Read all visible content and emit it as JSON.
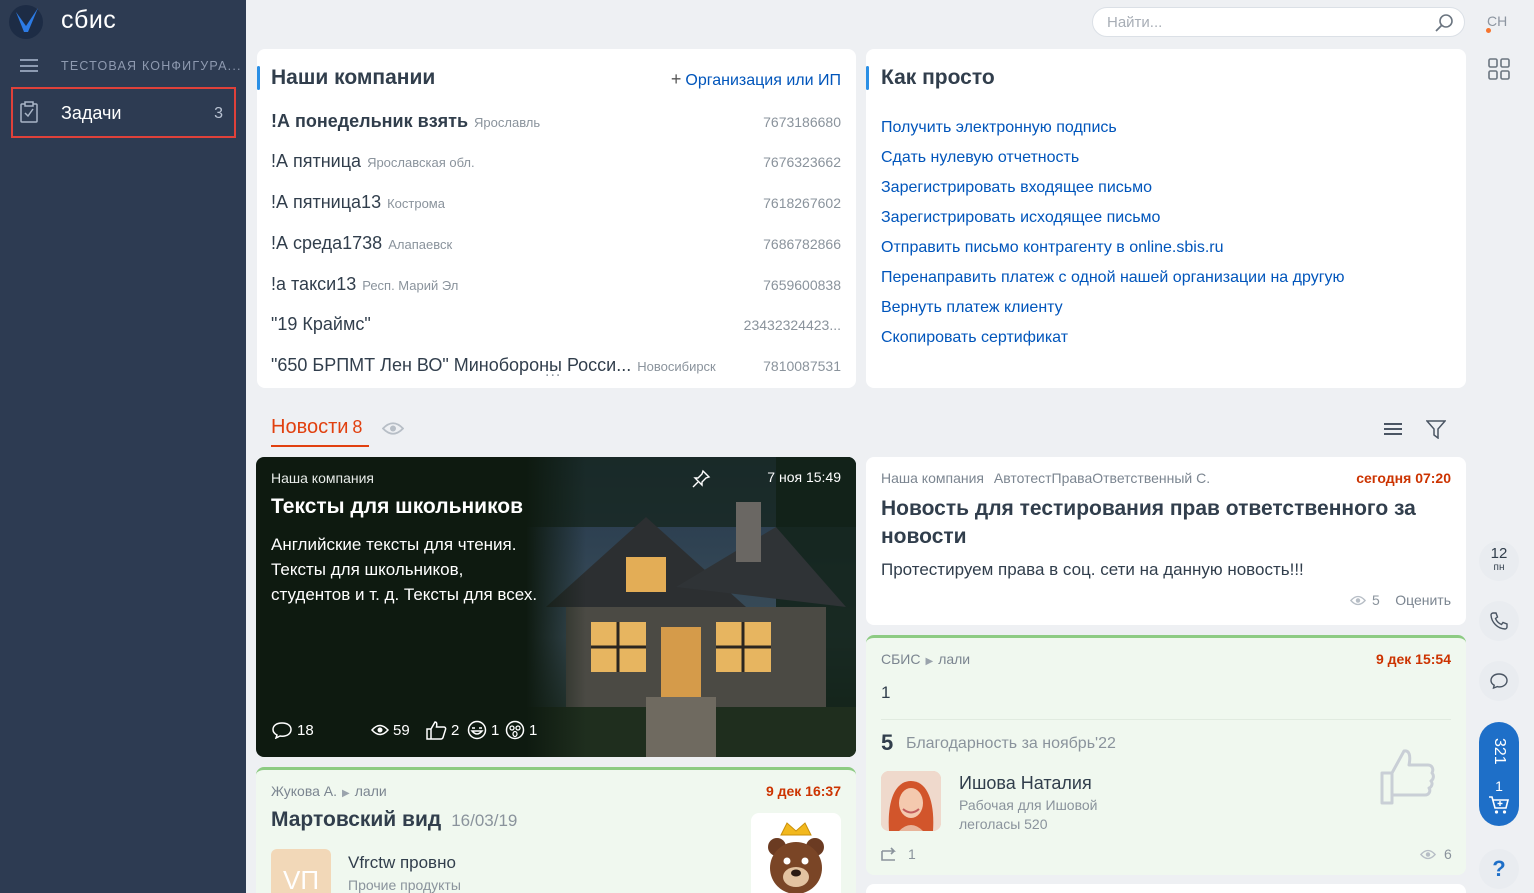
{
  "sidebar": {
    "brand": "сбис",
    "config": "ТЕСТОВАЯ КОНФИГУРА...",
    "nav_item": {
      "label": "Задачи",
      "count": "3"
    }
  },
  "topbar": {
    "search_placeholder": "Найти...",
    "user_initials": "СН"
  },
  "companies": {
    "title": "Наши компании",
    "add_label": "Организация или ИП",
    "rows": [
      {
        "name": "!А понедельник взять",
        "city": "Ярославль",
        "inn": "7673186680"
      },
      {
        "name": "!А пятница",
        "city": "Ярославская обл.",
        "inn": "7676323662"
      },
      {
        "name": "!А пятница13",
        "city": "Кострома",
        "inn": "7618267602"
      },
      {
        "name": "!А среда1738",
        "city": "Алапаевск",
        "inn": "7686782866"
      },
      {
        "name": "!а такси13",
        "city": "Респ. Марий Эл",
        "inn": "7659600838"
      },
      {
        "name": "\"19 Краймс\"",
        "city": "",
        "inn": "23432324423..."
      },
      {
        "name": "\"650 БРПМТ Лен ВО\" Минобороны Росси...",
        "city": "Новосибирск",
        "inn": "7810087531"
      }
    ],
    "more": "..."
  },
  "howto": {
    "title": "Как просто",
    "links": [
      "Получить электронную подпись",
      "Сдать нулевую отчетность",
      "Зарегистрировать входящее письмо",
      "Зарегистрировать исходящее письмо",
      "Отправить письмо контрагенту в online.sbis.ru",
      "Перенаправить платеж с одной нашей организации на другую",
      "Вернуть платеж клиенту",
      "Скопировать сертификат"
    ]
  },
  "news": {
    "title": "Новости",
    "count": "8",
    "featured": {
      "company": "Наша компания",
      "date": "7 ноя 15:49",
      "title": "Тексты для школьников",
      "text": "Английские тексты для чтения. Тексты для школьников, студентов и т. д. Тексты для всех.",
      "comments": "18",
      "views": "59",
      "likes": "2",
      "laughs": "1",
      "wows": "1"
    },
    "item1": {
      "company": "Наша компания",
      "author": "АвтотестПраваОтветственный С.",
      "date": "сегодня 07:20",
      "title": "Новость для тестирования прав ответственного за новости",
      "text": "Протестируем права в соц. сети на данную новость!!!",
      "views": "5",
      "rate": "Оценить"
    },
    "item2": {
      "source": "СБИС",
      "channel": "лали",
      "date": "9 дек 15:54",
      "body": "1",
      "thanks_num": "5",
      "thanks_text": "Благодарность за ноябрь'22",
      "person_name": "Ишова Наталия",
      "person_role": "Рабочая для Ишовой",
      "person_place": "леголасы 520",
      "reposts": "1",
      "views": "6"
    },
    "item3": {
      "author": "Жукова А.",
      "channel": "лали",
      "date": "9 дек 16:37",
      "title": "Мартовский вид",
      "sub_date": "16/03/19",
      "badge": "VП",
      "product_name": "Vfrctw провно",
      "product_cat": "Прочие продукты"
    }
  },
  "rail": {
    "day": "12",
    "weekday": "пн",
    "cart_count": "321",
    "cart_items": "1",
    "help": "?"
  },
  "colors": {
    "sidebar": "#2d3b52",
    "accent": "#e1400f",
    "link": "#0055bb",
    "date_red": "#cc3300",
    "green_card": "#f0f8ef",
    "highlight": "#e0413a"
  }
}
